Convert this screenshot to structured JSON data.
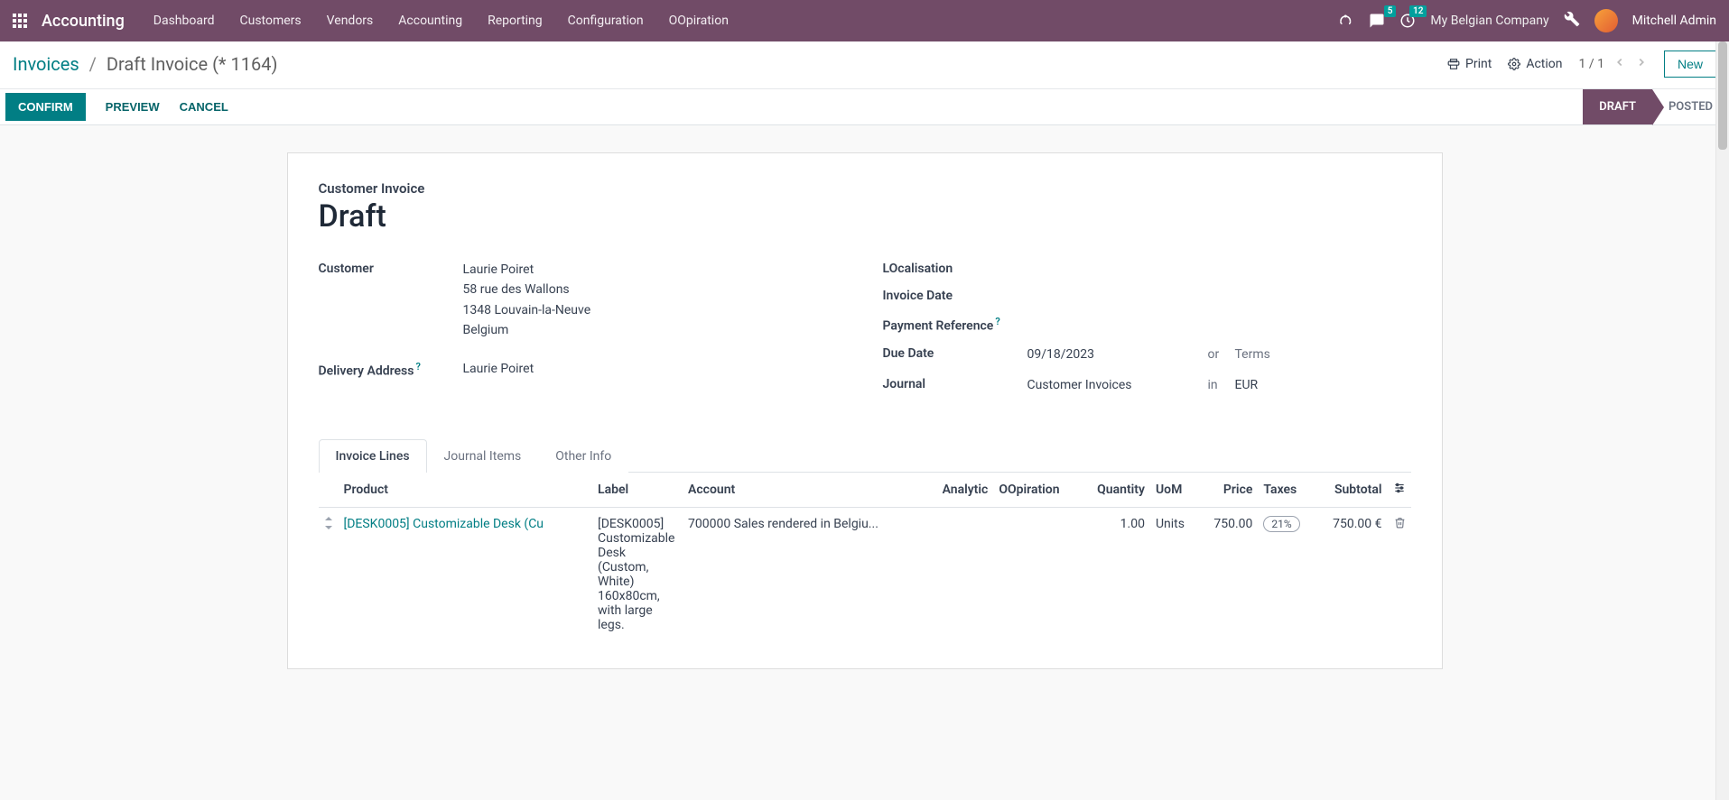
{
  "navbar": {
    "brand": "Accounting",
    "items": [
      "Dashboard",
      "Customers",
      "Vendors",
      "Accounting",
      "Reporting",
      "Configuration",
      "OOpiration"
    ],
    "messages_count": "5",
    "activities_count": "12",
    "company": "My Belgian Company",
    "user": "Mitchell Admin"
  },
  "breadcrumb": {
    "root": "Invoices",
    "current": "Draft Invoice (* 1164)"
  },
  "controls": {
    "print": "Print",
    "action": "Action",
    "pager": "1 / 1",
    "new": "New"
  },
  "statusbar": {
    "confirm": "CONFIRM",
    "preview": "PREVIEW",
    "cancel": "CANCEL",
    "draft": "DRAFT",
    "posted": "POSTED"
  },
  "form": {
    "subtitle": "Customer Invoice",
    "title": "Draft",
    "labels": {
      "customer": "Customer",
      "delivery_address": "Delivery Address",
      "localisation": "LOcalisation",
      "invoice_date": "Invoice Date",
      "payment_ref": "Payment Reference",
      "due_date": "Due Date",
      "or": "or",
      "terms": "Terms",
      "journal": "Journal",
      "in": "in",
      "currency": "EUR"
    },
    "customer": {
      "name": "Laurie Poiret",
      "street": "58 rue des Wallons",
      "city": "1348 Louvain-la-Neuve",
      "country": "Belgium"
    },
    "delivery_address": "Laurie Poiret",
    "due_date": "09/18/2023",
    "journal": "Customer Invoices"
  },
  "tabs": [
    "Invoice Lines",
    "Journal Items",
    "Other Info"
  ],
  "table": {
    "headers": {
      "product": "Product",
      "label": "Label",
      "account": "Account",
      "analytic": "Analytic",
      "oopiration": "OOpiration",
      "quantity": "Quantity",
      "uom": "UoM",
      "price": "Price",
      "taxes": "Taxes",
      "subtotal": "Subtotal"
    },
    "rows": [
      {
        "product": "[DESK0005] Customizable Desk (Cu",
        "label": "[DESK0005] Customizable Desk (Custom, White) 160x80cm, with large legs.",
        "account": "700000 Sales rendered in Belgiu...",
        "analytic": "",
        "oopiration": "",
        "quantity": "1.00",
        "uom": "Units",
        "price": "750.00",
        "tax": "21%",
        "subtotal": "750.00 €"
      }
    ]
  }
}
